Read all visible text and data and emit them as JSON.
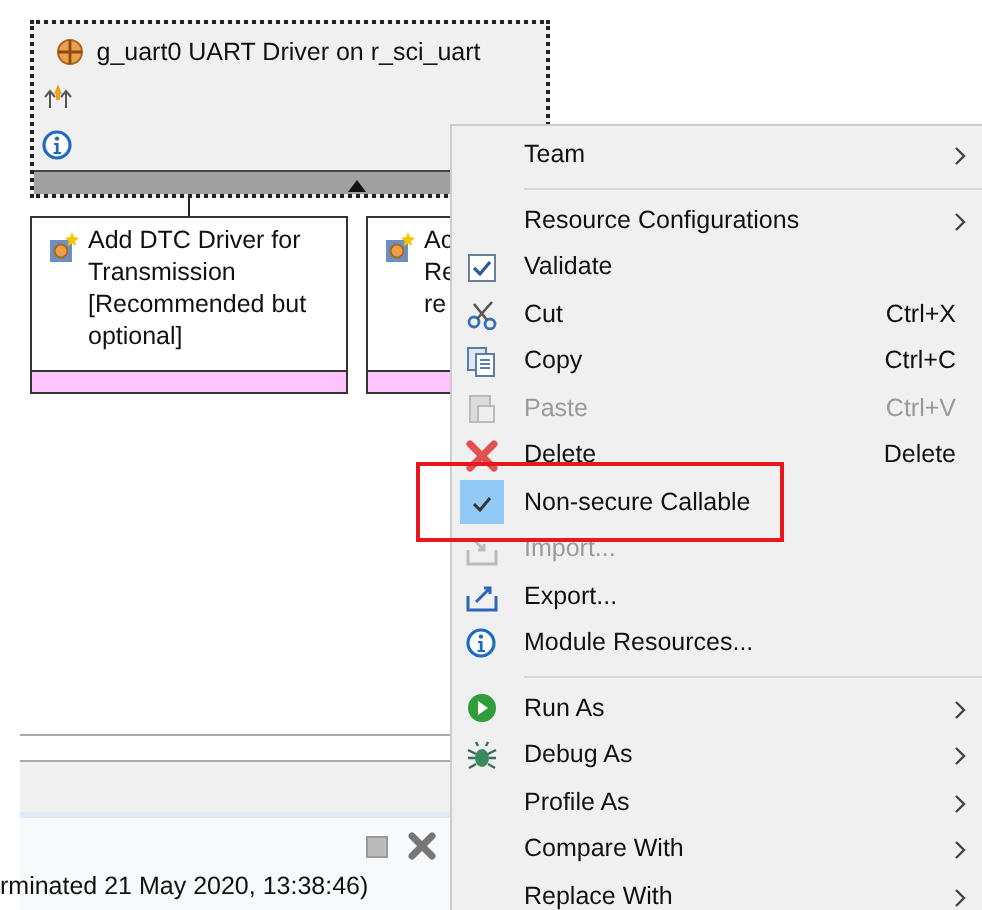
{
  "module": {
    "title": "g_uart0 UART Driver on r_sci_uart"
  },
  "children": [
    {
      "lines": [
        "Add DTC Driver for",
        "Transmission",
        "[Recommended but",
        "optional]"
      ]
    },
    {
      "lines": [
        "Ac",
        "Re",
        "re"
      ]
    }
  ],
  "console": {
    "status": "rminated 21 May 2020, 13:38:46)"
  },
  "context_menu": {
    "items": [
      {
        "kind": "item",
        "label": "Team",
        "submenu": true,
        "disabled": false,
        "checked": false,
        "highlighted": false
      },
      {
        "kind": "separator"
      },
      {
        "kind": "item",
        "label": "Resource Configurations",
        "submenu": true,
        "disabled": false,
        "checked": false,
        "highlighted": false
      },
      {
        "kind": "item",
        "label": "Validate",
        "submenu": false,
        "disabled": false,
        "checked": false,
        "highlighted": false
      },
      {
        "kind": "item",
        "label": "Cut",
        "shortcut": "Ctrl+X",
        "submenu": false,
        "disabled": false,
        "checked": false,
        "highlighted": false
      },
      {
        "kind": "item",
        "label": "Copy",
        "shortcut": "Ctrl+C",
        "submenu": false,
        "disabled": false,
        "checked": false,
        "highlighted": false
      },
      {
        "kind": "item",
        "label": "Paste",
        "shortcut": "Ctrl+V",
        "submenu": false,
        "disabled": true,
        "checked": false,
        "highlighted": false
      },
      {
        "kind": "item",
        "label": "Delete",
        "shortcut": "Delete",
        "submenu": false,
        "disabled": false,
        "checked": false,
        "highlighted": false
      },
      {
        "kind": "item",
        "label": "Non-secure Callable",
        "submenu": false,
        "disabled": false,
        "checked": true,
        "highlighted": true
      },
      {
        "kind": "item",
        "label": "Import...",
        "submenu": false,
        "disabled": true,
        "checked": false,
        "highlighted": false
      },
      {
        "kind": "item",
        "label": "Export...",
        "submenu": false,
        "disabled": false,
        "checked": false,
        "highlighted": false
      },
      {
        "kind": "item",
        "label": "Module Resources...",
        "submenu": false,
        "disabled": false,
        "checked": false,
        "highlighted": false
      },
      {
        "kind": "separator"
      },
      {
        "kind": "item",
        "label": "Run As",
        "submenu": true,
        "disabled": false,
        "checked": false,
        "highlighted": false
      },
      {
        "kind": "item",
        "label": "Debug As",
        "submenu": true,
        "disabled": false,
        "checked": false,
        "highlighted": false
      },
      {
        "kind": "item",
        "label": "Profile As",
        "submenu": true,
        "disabled": false,
        "checked": false,
        "highlighted": false
      },
      {
        "kind": "item",
        "label": "Compare With",
        "submenu": true,
        "disabled": false,
        "checked": false,
        "highlighted": false
      },
      {
        "kind": "item",
        "label": "Replace With",
        "submenu": true,
        "disabled": false,
        "checked": false,
        "highlighted": false
      }
    ]
  }
}
